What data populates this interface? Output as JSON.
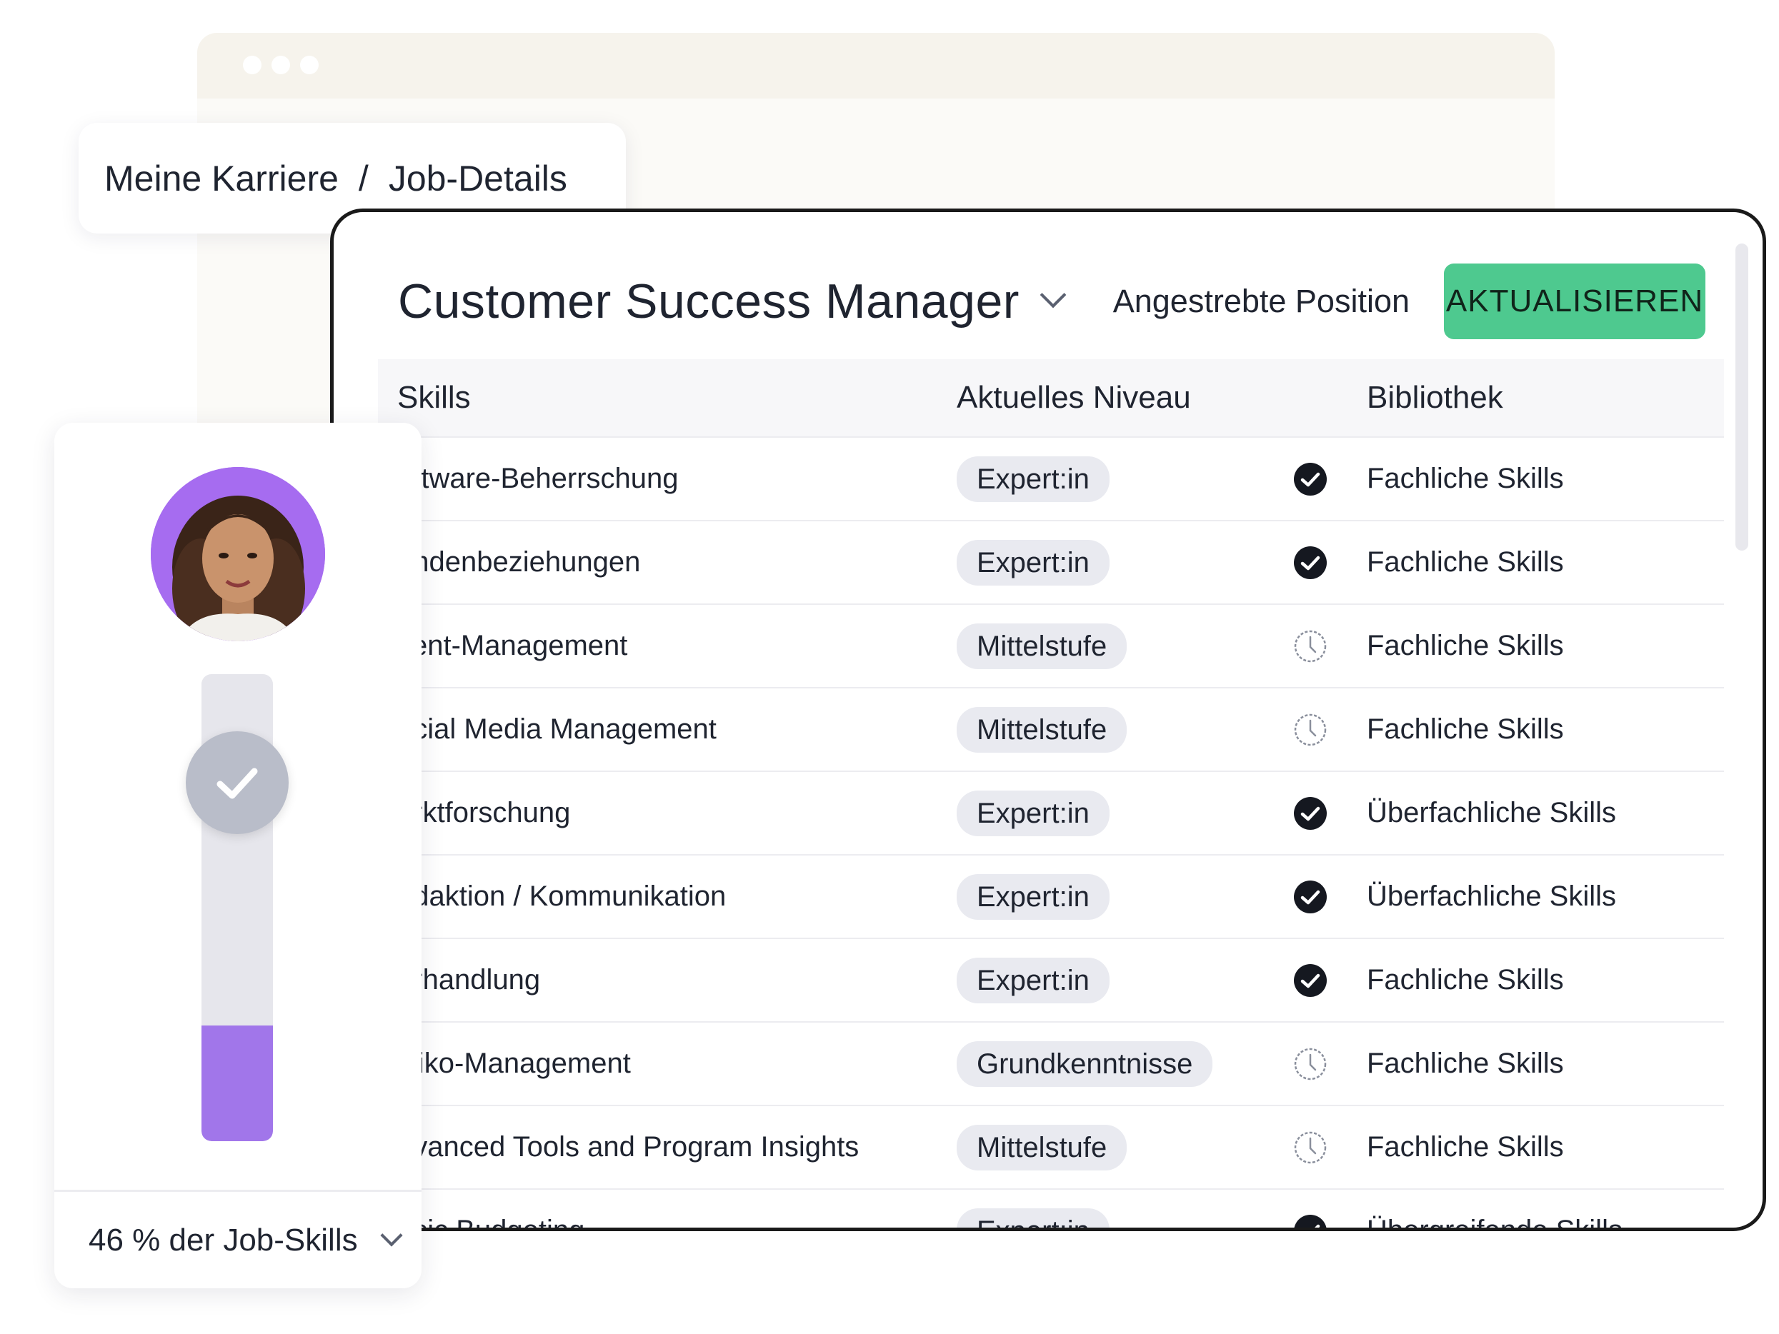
{
  "breadcrumb": {
    "parent": "Meine Karriere",
    "separator": "/",
    "current": "Job-Details"
  },
  "job": {
    "title": "Customer Success Manager",
    "target_label": "Angestrebte Position",
    "update_label": "AKTUALISIEREN"
  },
  "table": {
    "headers": {
      "skills": "Skills",
      "level": "Aktuelles Niveau",
      "library": "Bibliothek"
    },
    "rows": [
      {
        "skill": "oftware-Beherrschung",
        "level": "Expert:in",
        "status": "check-circle-icon",
        "library": "Fachliche Skills"
      },
      {
        "skill": "undenbeziehungen",
        "level": "Expert:in",
        "status": "check-circle-icon",
        "library": "Fachliche Skills"
      },
      {
        "skill": "vent-Management",
        "level": "Mittelstufe",
        "status": "clock-icon",
        "library": "Fachliche Skills"
      },
      {
        "skill": "ocial Media Management",
        "level": "Mittelstufe",
        "status": "clock-icon",
        "library": "Fachliche Skills"
      },
      {
        "skill": "arktforschung",
        "level": "Expert:in",
        "status": "check-circle-icon",
        "library": "Überfachliche Skills"
      },
      {
        "skill": "edaktion / Kommunikation",
        "level": "Expert:in",
        "status": "check-circle-icon",
        "library": "Überfachliche Skills"
      },
      {
        "skill": "erhandlung",
        "level": "Expert:in",
        "status": "check-circle-icon",
        "library": "Fachliche Skills"
      },
      {
        "skill": "isiko-Management",
        "level": "Grundkenntnisse",
        "status": "clock-icon",
        "library": "Fachliche Skills"
      },
      {
        "skill": "dvanced Tools and Program Insights",
        "level": "Mittelstufe",
        "status": "clock-icon",
        "library": "Fachliche Skills"
      },
      {
        "skill": "asic Budgeting",
        "level": "Expert:in",
        "status": "check-circle-icon",
        "library": "Übergreifende Skills"
      }
    ]
  },
  "progress": {
    "percent": 46,
    "label": "46 % der Job-Skills"
  },
  "colors": {
    "accent_green": "#4ec98f",
    "accent_purple": "#a176ea",
    "avatar_bg": "#a66cf0"
  }
}
